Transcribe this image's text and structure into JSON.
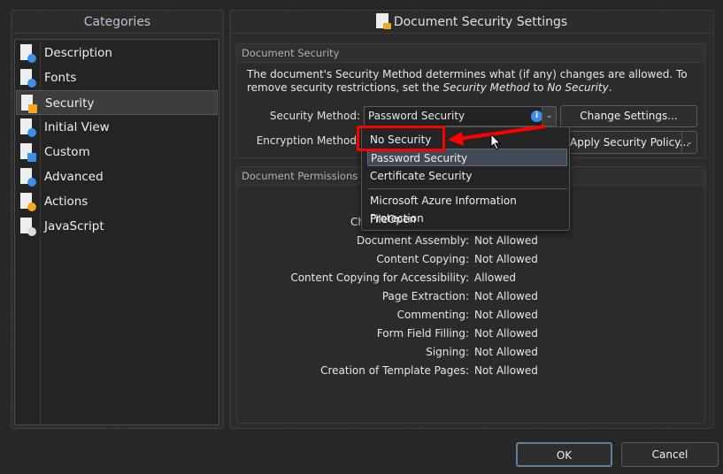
{
  "sidebar": {
    "title": "Categories",
    "items": [
      {
        "label": "Description",
        "icon": "document-info-icon"
      },
      {
        "label": "Fonts",
        "icon": "document-font-icon"
      },
      {
        "label": "Security",
        "icon": "document-lock-icon",
        "selected": true
      },
      {
        "label": "Initial View",
        "icon": "document-magnifier-icon"
      },
      {
        "label": "Custom",
        "icon": "document-field-icon"
      },
      {
        "label": "Advanced",
        "icon": "document-gear-icon"
      },
      {
        "label": "Actions",
        "icon": "document-lightning-icon"
      },
      {
        "label": "JavaScript",
        "icon": "script-scroll-icon"
      }
    ]
  },
  "main": {
    "title": "Document Security Settings",
    "security_group": {
      "title": "Document Security",
      "desc_1": "The document's Security Method determines what (if any) changes are allowed. To remove security restrictions, set the ",
      "desc_em1": "Security Method",
      "desc_2": " to ",
      "desc_em2": "No Security",
      "desc_3": ".",
      "security_method_label": "Security Method:",
      "security_method_value": "Password Security",
      "change_settings": "Change Settings...",
      "encryption_method_label": "Encryption Method:",
      "apply_policy": "Apply Security Policy..."
    },
    "dropdown": {
      "options": [
        "No Security",
        "Password Security",
        "Certificate Security",
        "Microsoft Azure Information Protection",
        "FileOpen"
      ],
      "highlighted": "Password Security"
    },
    "permissions_group": {
      "title": "Document Permissions De",
      "partial_label": "Ch",
      "rows": [
        {
          "label": "Document Assembly:",
          "value": "Not Allowed"
        },
        {
          "label": "Content Copying:",
          "value": "Not Allowed"
        },
        {
          "label": "Content Copying for Accessibility:",
          "value": "Allowed"
        },
        {
          "label": "Page Extraction:",
          "value": "Not Allowed"
        },
        {
          "label": "Commenting:",
          "value": "Not Allowed"
        },
        {
          "label": "Form Field Filling:",
          "value": "Not Allowed"
        },
        {
          "label": "Signing:",
          "value": "Not Allowed"
        },
        {
          "label": "Creation of Template Pages:",
          "value": "Not Allowed"
        }
      ]
    }
  },
  "footer": {
    "ok": "OK",
    "cancel": "Cancel"
  },
  "colors": {
    "annotation_red": "#ff0000",
    "info_blue": "#3b8eea",
    "lock_orange": "#f5a623"
  }
}
